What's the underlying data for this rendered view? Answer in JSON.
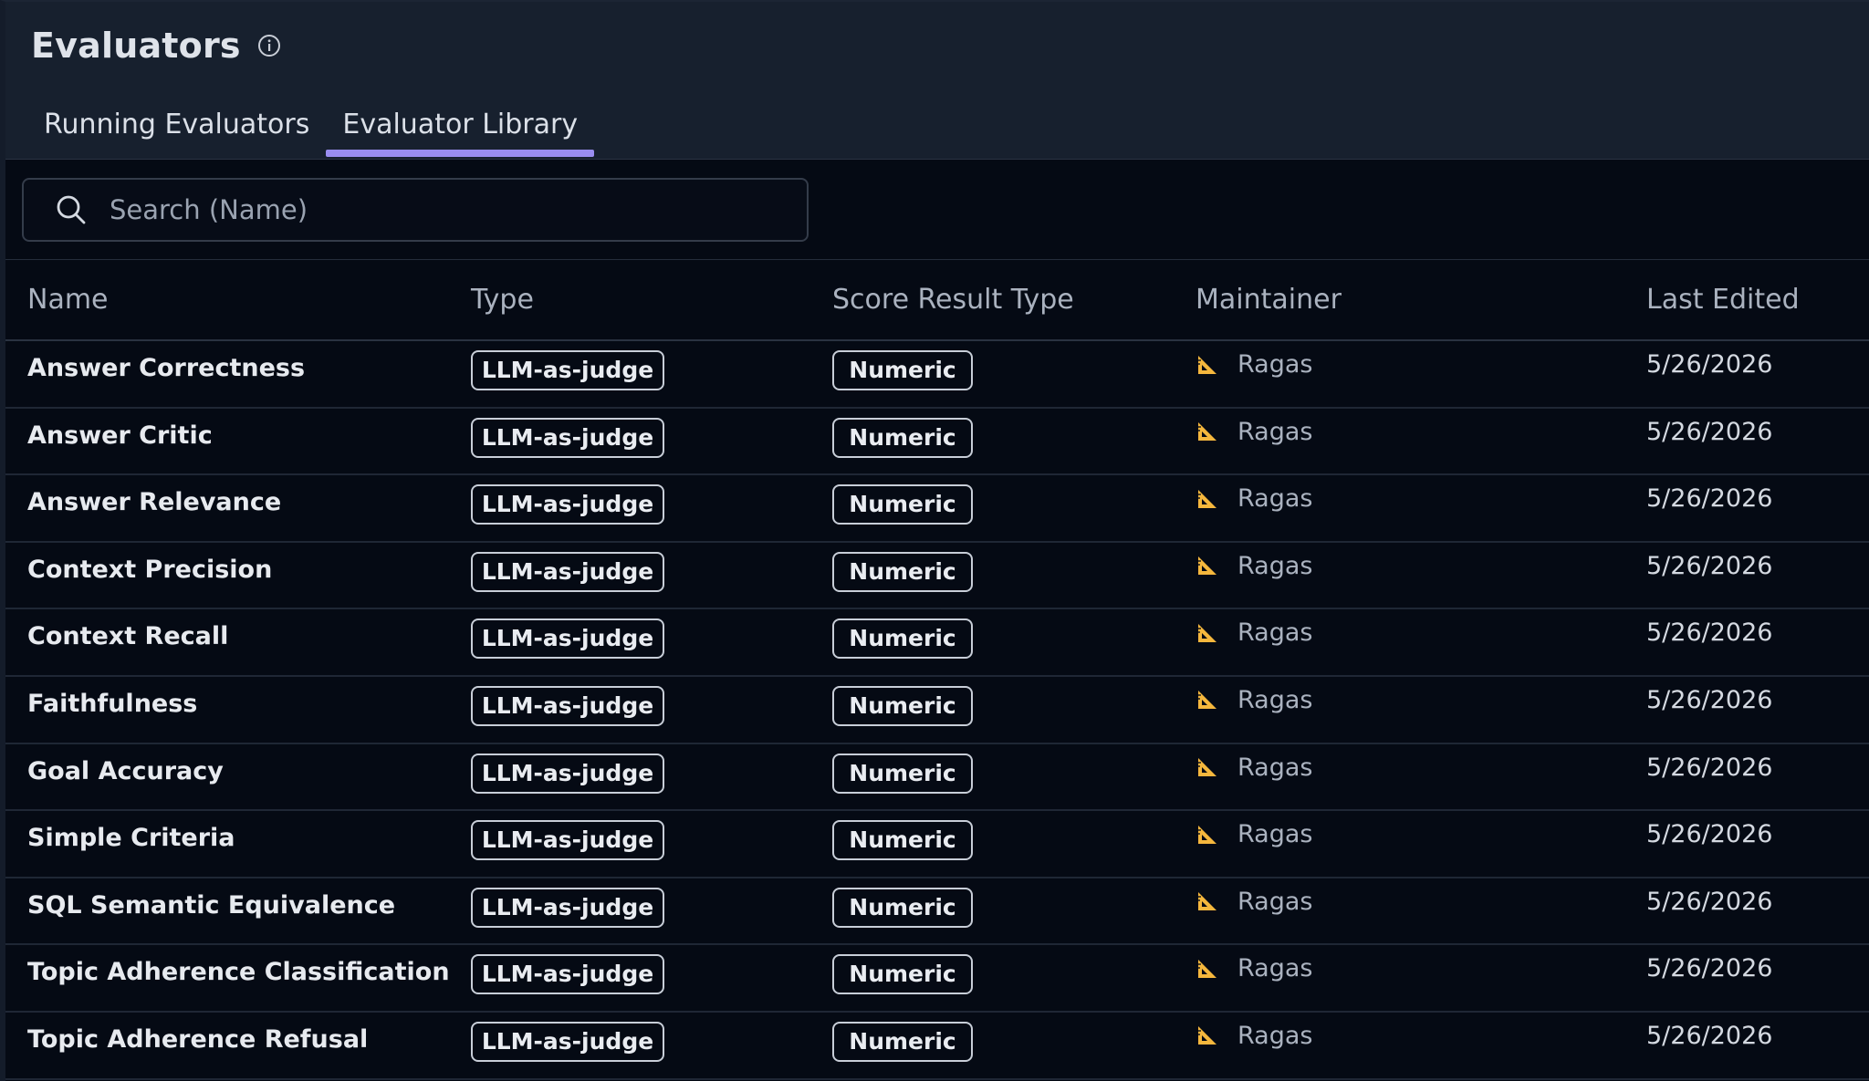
{
  "header": {
    "title": "Evaluators",
    "tabs": [
      {
        "label": "Running Evaluators",
        "active": false
      },
      {
        "label": "Evaluator Library",
        "active": true
      }
    ],
    "accent_color": "#9a8df0"
  },
  "search": {
    "placeholder": "Search (Name)",
    "value": ""
  },
  "table": {
    "columns": [
      "Name",
      "Type",
      "Score Result Type",
      "Maintainer",
      "Last Edited"
    ],
    "rows": [
      {
        "name": "Answer Correctness",
        "type": "LLM-as-judge",
        "score": "Numeric",
        "maintainer": "Ragas",
        "edited": "5/26/2026"
      },
      {
        "name": "Answer Critic",
        "type": "LLM-as-judge",
        "score": "Numeric",
        "maintainer": "Ragas",
        "edited": "5/26/2026"
      },
      {
        "name": "Answer Relevance",
        "type": "LLM-as-judge",
        "score": "Numeric",
        "maintainer": "Ragas",
        "edited": "5/26/2026"
      },
      {
        "name": "Context Precision",
        "type": "LLM-as-judge",
        "score": "Numeric",
        "maintainer": "Ragas",
        "edited": "5/26/2026"
      },
      {
        "name": "Context Recall",
        "type": "LLM-as-judge",
        "score": "Numeric",
        "maintainer": "Ragas",
        "edited": "5/26/2026"
      },
      {
        "name": "Faithfulness",
        "type": "LLM-as-judge",
        "score": "Numeric",
        "maintainer": "Ragas",
        "edited": "5/26/2026"
      },
      {
        "name": "Goal Accuracy",
        "type": "LLM-as-judge",
        "score": "Numeric",
        "maintainer": "Ragas",
        "edited": "5/26/2026"
      },
      {
        "name": "Simple Criteria",
        "type": "LLM-as-judge",
        "score": "Numeric",
        "maintainer": "Ragas",
        "edited": "5/26/2026"
      },
      {
        "name": "SQL Semantic Equivalence",
        "type": "LLM-as-judge",
        "score": "Numeric",
        "maintainer": "Ragas",
        "edited": "5/26/2026"
      },
      {
        "name": "Topic Adherence Classification",
        "type": "LLM-as-judge",
        "score": "Numeric",
        "maintainer": "Ragas",
        "edited": "5/26/2026"
      },
      {
        "name": "Topic Adherence Refusal",
        "type": "LLM-as-judge",
        "score": "Numeric",
        "maintainer": "Ragas",
        "edited": "5/26/2026"
      }
    ],
    "maintainer_icon": "ruler-triangle-icon",
    "maintainer_icon_color": "#f5b73d"
  }
}
